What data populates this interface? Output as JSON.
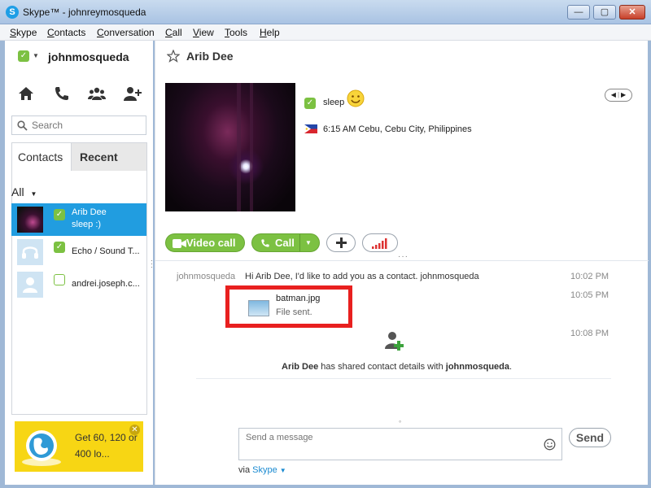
{
  "window": {
    "title": "Skype™ - johnreymosqueda",
    "minimize": "—",
    "maximize": "▢",
    "close": "✕"
  },
  "menu": [
    "Skype",
    "Contacts",
    "Conversation",
    "Call",
    "View",
    "Tools",
    "Help"
  ],
  "sidebar": {
    "username": "johnmosqueda",
    "search_placeholder": "Search",
    "tabs": {
      "contacts": "Contacts",
      "recent": "Recent"
    },
    "filter": "All",
    "contacts": [
      {
        "name": "Arib Dee",
        "status": "sleep :)"
      },
      {
        "name": "Echo / Sound T..."
      },
      {
        "name": "andrei.joseph.c..."
      }
    ],
    "promo": {
      "text": "Get 60, 120 or 400 lo..."
    }
  },
  "conversation": {
    "title": "Arib Dee",
    "mood": "sleep",
    "location": "6:15 AM Cebu, Cebu City, Philippines",
    "buttons": {
      "video_call": "Video call",
      "call": "Call"
    },
    "messages": [
      {
        "sender": "johnmosqueda",
        "text": "Hi Arib Dee, I'd like to add you as a contact. johnmosqueda",
        "time": "10:02 PM"
      },
      {
        "file_name": "batman.jpg",
        "file_status": "File sent.",
        "time": "10:05 PM"
      },
      {
        "time": "10:08 PM",
        "shared_name": "Arib Dee",
        "shared_text": " has shared contact details with ",
        "shared_target": "johnmosqueda",
        "shared_end": "."
      }
    ],
    "compose_placeholder": "Send a message",
    "send_label": "Send",
    "via_prefix": "via ",
    "via_service": "Skype"
  },
  "colors": {
    "skype_blue": "#219de0",
    "skype_green": "#7cc142",
    "highlight_red": "#e8201f",
    "promo_yellow": "#f7d614"
  }
}
